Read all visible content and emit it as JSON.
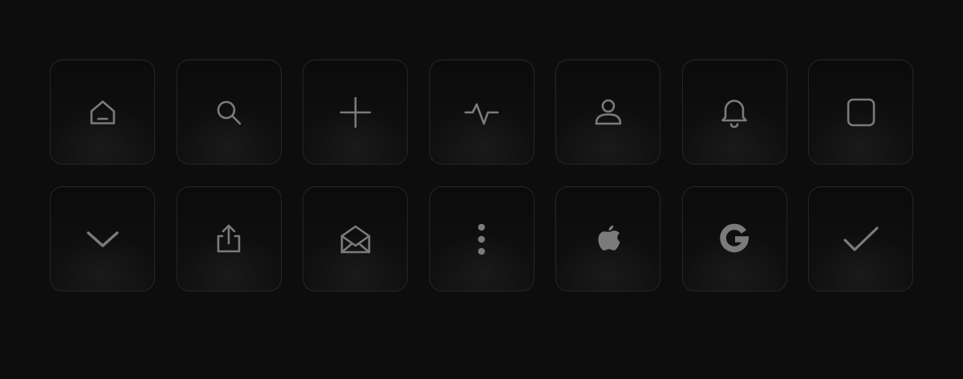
{
  "theme": {
    "background": "#0d0d0d",
    "tile_border": "#262626",
    "icon_color": "#7b7b7b"
  },
  "icons": [
    "home-icon",
    "search-icon",
    "plus-icon",
    "activity-icon",
    "user-icon",
    "bell-icon",
    "square-icon",
    "chevron-down-icon",
    "share-icon",
    "mail-open-icon",
    "more-vertical-icon",
    "apple-logo-icon",
    "google-logo-icon",
    "check-icon"
  ]
}
